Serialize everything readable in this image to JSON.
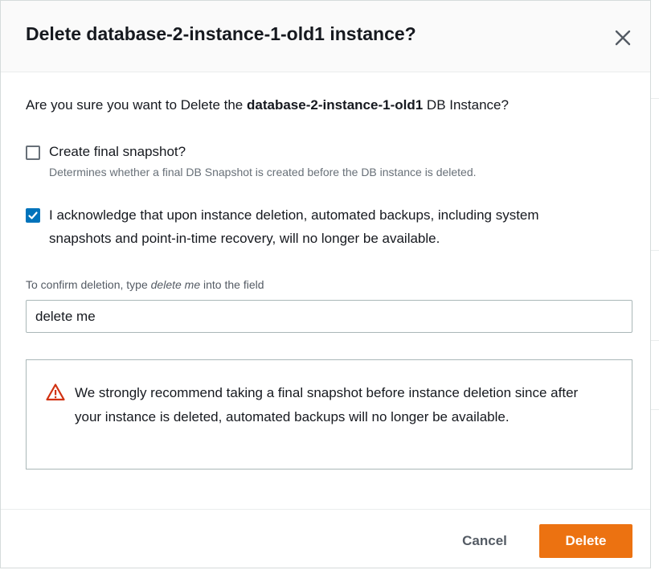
{
  "modal": {
    "title": "Delete database-2-instance-1-old1 instance?",
    "prompt_prefix": "Are you sure you want to Delete the ",
    "prompt_instance": "database-2-instance-1-old1",
    "prompt_suffix": " DB Instance?",
    "final_snapshot": {
      "label": "Create final snapshot?",
      "description": "Determines whether a final DB Snapshot is created before the DB instance is deleted.",
      "checked": false
    },
    "acknowledge": {
      "label_line1": "I acknowledge that upon instance deletion, automated backups, including system",
      "label_line2": "snapshots and point-in-time recovery, will no longer be available.",
      "checked": true
    },
    "confirm": {
      "label_prefix": "To confirm deletion, type ",
      "label_keyword": "delete me",
      "label_suffix": " into the field",
      "value": "delete me"
    },
    "alert": {
      "icon": "warning-triangle-icon",
      "text": "We strongly recommend taking a final snapshot before instance deletion since after your instance is deleted, automated backups will no longer be available."
    },
    "footer": {
      "cancel_label": "Cancel",
      "delete_label": "Delete"
    }
  },
  "colors": {
    "primary": "#ec7211",
    "checkbox": "#0073bb",
    "warning": "#d13212",
    "text": "#16191f",
    "muted": "#687078"
  }
}
